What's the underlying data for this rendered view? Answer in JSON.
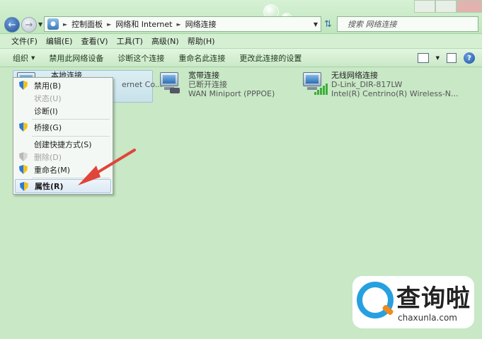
{
  "address_bar": {
    "crumbs": [
      "控制面板",
      "网络和 Internet",
      "网络连接"
    ],
    "search_placeholder": "搜索 网络连接"
  },
  "menu_bar": {
    "items": [
      "文件(F)",
      "编辑(E)",
      "查看(V)",
      "工具(T)",
      "高级(N)",
      "帮助(H)"
    ]
  },
  "toolbar": {
    "organize": "组织",
    "items": [
      "禁用此网络设备",
      "诊断这个连接",
      "重命名此连接",
      "更改此连接的设置"
    ]
  },
  "connections": [
    {
      "name": "本地连接",
      "status": "",
      "device": "ernet Co..."
    },
    {
      "name": "宽带连接",
      "status": "已断开连接",
      "device": "WAN Miniport (PPPOE)"
    },
    {
      "name": "无线网络连接",
      "status": "D-Link_DIR-817LW",
      "device": "Intel(R) Centrino(R) Wireless-N..."
    }
  ],
  "context_menu": {
    "items": [
      {
        "label": "禁用(B)",
        "enabled": true,
        "shield": true
      },
      {
        "label": "状态(U)",
        "enabled": false,
        "shield": false
      },
      {
        "label": "诊断(I)",
        "enabled": true,
        "shield": false
      },
      {
        "label": "桥接(G)",
        "enabled": true,
        "shield": true
      },
      {
        "label": "创建快捷方式(S)",
        "enabled": true,
        "shield": false
      },
      {
        "label": "删除(D)",
        "enabled": false,
        "shield": true
      },
      {
        "label": "重命名(M)",
        "enabled": true,
        "shield": true
      },
      {
        "label": "属性(R)",
        "enabled": true,
        "shield": true,
        "highlighted": true
      }
    ]
  },
  "watermark": {
    "brand": "查询啦",
    "domain": "chaxunla.com"
  },
  "colors": {
    "background": "#c8e8c6",
    "arrow": "#e0453a",
    "accent_blue": "#27a0e0"
  }
}
